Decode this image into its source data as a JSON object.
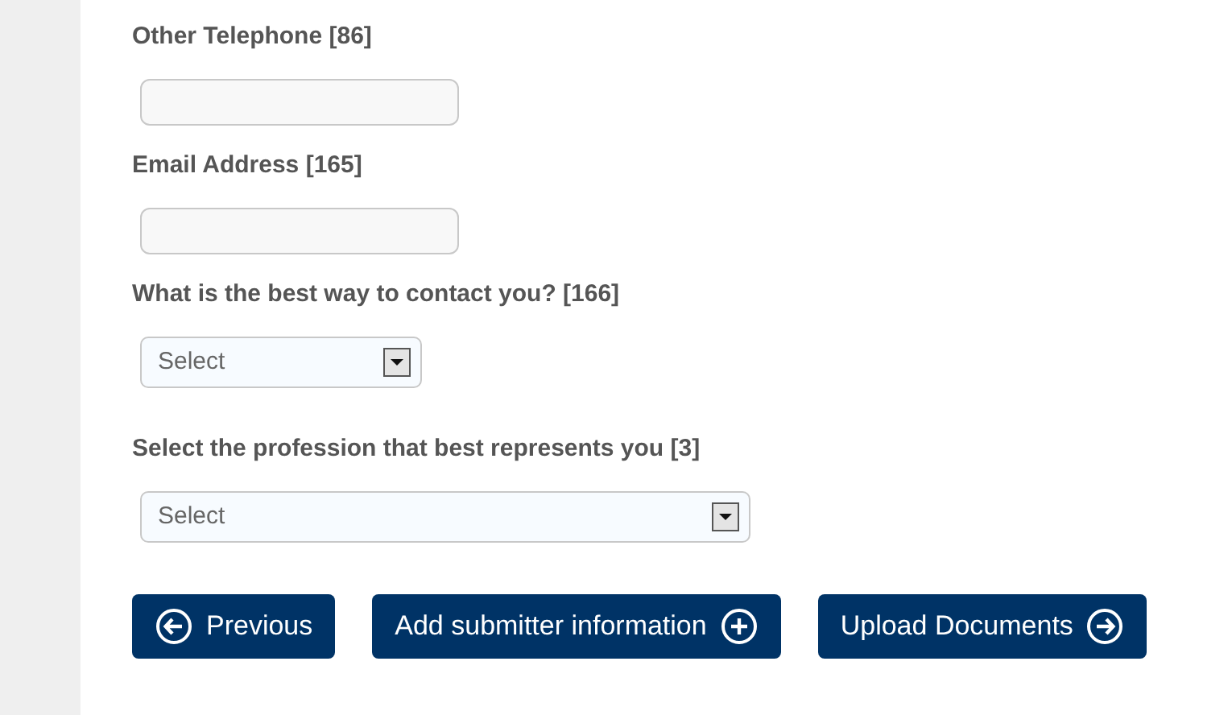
{
  "fields": [
    {
      "kind": "text",
      "label": "Other Telephone [86]"
    },
    {
      "kind": "text",
      "label": "Email Address [165]"
    },
    {
      "kind": "select",
      "label": "What is the best way to contact you? [166]",
      "value": "Select"
    },
    {
      "kind": "select",
      "label": "Select the profession that best represents you [3]",
      "value": "Select"
    }
  ],
  "buttons": [
    {
      "label": "Previous"
    },
    {
      "label": "Add submitter information"
    },
    {
      "label": "Upload Documents"
    }
  ]
}
